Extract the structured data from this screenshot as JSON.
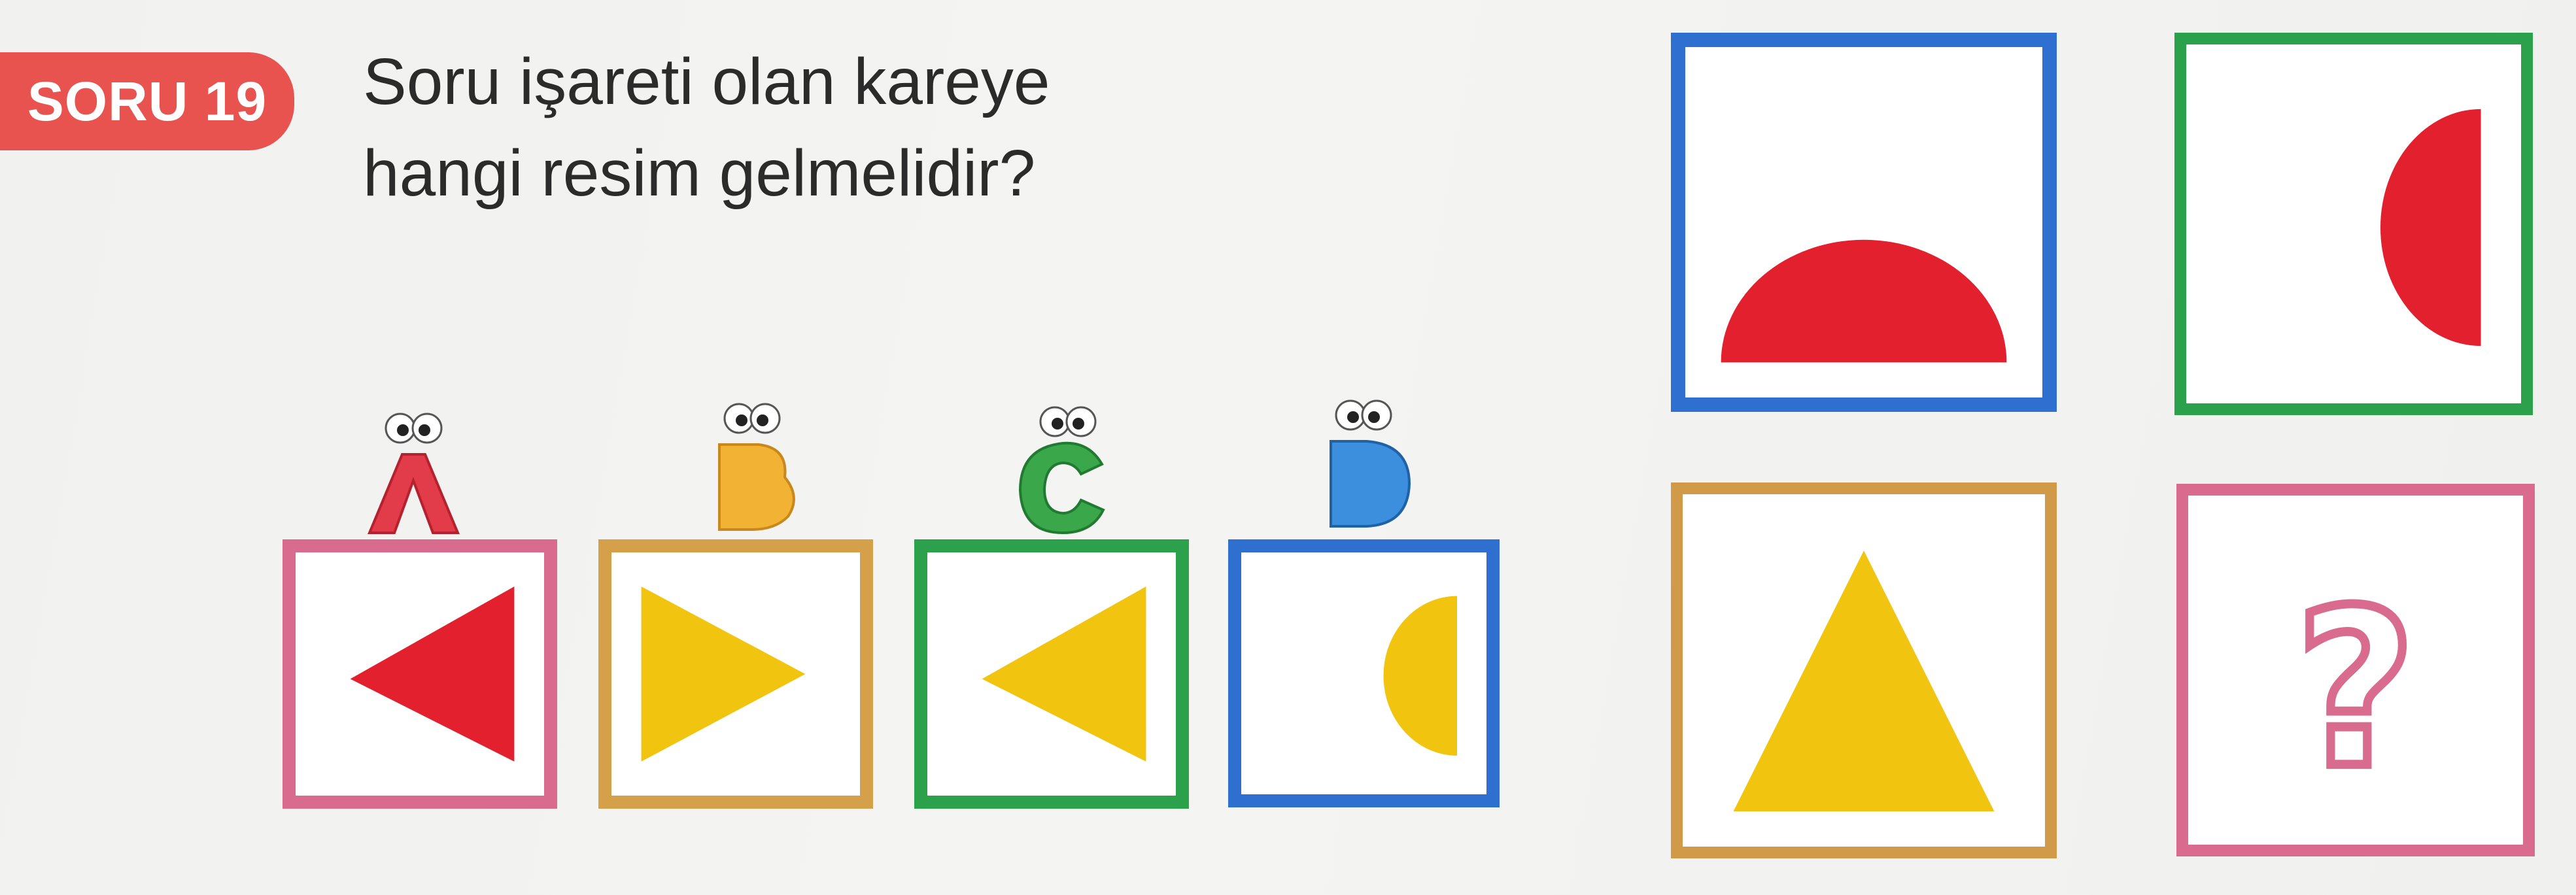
{
  "question": {
    "badge": "SORU 19",
    "line1": "Soru işareti olan kareye",
    "line2": "hangi resim gelmelidir?"
  },
  "options": [
    {
      "letter": "A",
      "shape": "triangle-left",
      "shape_color": "#e3202e",
      "border_color": "#d96b8e"
    },
    {
      "letter": "B",
      "shape": "triangle-right",
      "shape_color": "#f1c40f",
      "border_color": "#d4a04a"
    },
    {
      "letter": "C",
      "shape": "triangle-left",
      "shape_color": "#f1c40f",
      "border_color": "#2aa14a"
    },
    {
      "letter": "D",
      "shape": "semicircle-left",
      "shape_color": "#f1c40f",
      "border_color": "#2e6fd0"
    }
  ],
  "grid": [
    {
      "shape": "semicircle-up",
      "shape_color": "#e3202e",
      "border_color": "#2e6fd0"
    },
    {
      "shape": "semicircle-left",
      "shape_color": "#e3202e",
      "border_color": "#2aa14a"
    },
    {
      "shape": "triangle-up",
      "shape_color": "#f1c40f",
      "border_color": "#d09a48"
    },
    {
      "shape": "question-mark",
      "symbol": "?",
      "shape_color": "#d96b8e",
      "border_color": "#d96b8e"
    }
  ],
  "colors": {
    "badge": "#e8524f",
    "question_text": "#2b2b2b",
    "letter_A": "#e23b4a",
    "letter_B": "#f2b233",
    "letter_C": "#3aa84a",
    "letter_D": "#3b8fdc",
    "red": "#e3202e",
    "yellow": "#f1c40f",
    "blue_border": "#2e6fd0",
    "green_border": "#2aa14a",
    "orange_border": "#d09a48",
    "pink_border": "#d96b8e"
  }
}
